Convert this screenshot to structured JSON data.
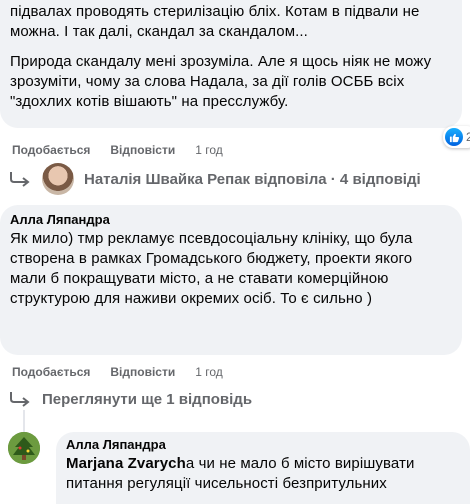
{
  "comment1": {
    "lines_para1": "підвалах проводять стерилізацію бліх. Котам в підвали не можна. І так далі, скандал за скандалом...",
    "para2": "Природа скандалу мені зрозуміла. Але я щось ніяк не можу зрозуміти, чому за слова Надала, за дії голів ОСББ всіх \"здохлих котів вішають\" на пресслужбу.",
    "like_label": "Подобається",
    "reply_label": "Відповісти",
    "time": "1 год",
    "reaction_count": "2",
    "replies_summary": "Наталія Швайка Репак відповіла · 4 відповіді"
  },
  "comment2": {
    "author": "Алла Ляпандра",
    "text": "Як мило) тмр рекламує псевдосоціальну клініку, що була створена в рамках Громадського бюджету, проекти якого мали б покращувати місто, а не ставати комерційною структурою для наживи окремих осіб. То є сильно )",
    "like_label": "Подобається",
    "reply_label": "Відповісти",
    "time": "1 год",
    "more_replies": "Переглянути ще 1 відповідь"
  },
  "comment3": {
    "author": "Алла Ляпандра",
    "mention": "Marjana Zvarych",
    "text": "а чи не мало б місто вирішувати питання регуляції чисельності безпритульних"
  },
  "colors": {
    "bubble": "#f0f2f5",
    "secondary_text": "#65676b",
    "primary_text": "#050505",
    "like_blue": "#1877f2"
  }
}
